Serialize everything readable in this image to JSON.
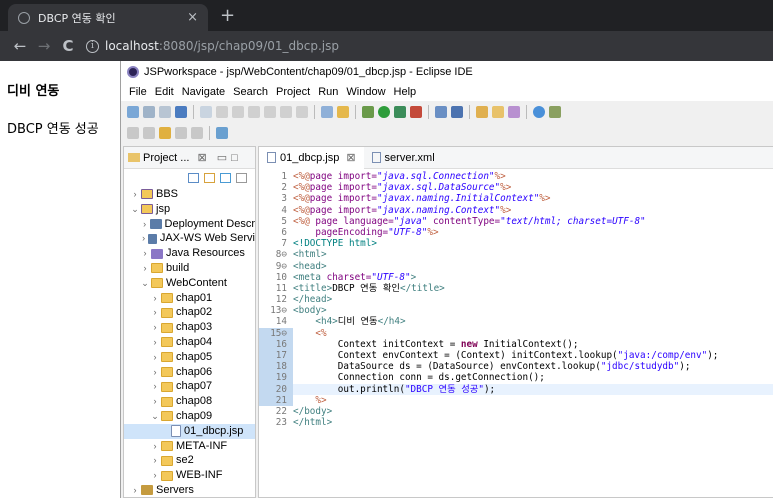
{
  "browser": {
    "tab_title": "DBCP 연동 확인",
    "tab_close": "×",
    "new_tab": "+",
    "url_host": "localhost",
    "url_rest": ":8080/jsp/chap09/01_dbcp.jsp"
  },
  "page": {
    "heading": "디비 연동",
    "message": "DBCP 연동 성공"
  },
  "eclipse": {
    "title": "JSPworkspace - jsp/WebContent/chap09/01_dbcp.jsp - Eclipse IDE",
    "menu": [
      "File",
      "Edit",
      "Navigate",
      "Search",
      "Project",
      "Run",
      "Window",
      "Help"
    ],
    "explorer_tab": "Project ...",
    "tree": [
      {
        "label": "BBS",
        "depth": 0,
        "twisty": ">",
        "icon": "proj"
      },
      {
        "label": "jsp",
        "depth": 0,
        "twisty": "v",
        "icon": "proj"
      },
      {
        "label": "Deployment Descr",
        "depth": 1,
        "twisty": ">",
        "icon": "web"
      },
      {
        "label": "JAX-WS Web Servi",
        "depth": 1,
        "twisty": ">",
        "icon": "web"
      },
      {
        "label": "Java Resources",
        "depth": 1,
        "twisty": ">",
        "icon": "lib"
      },
      {
        "label": "build",
        "depth": 1,
        "twisty": ">",
        "icon": "folder"
      },
      {
        "label": "WebContent",
        "depth": 1,
        "twisty": "v",
        "icon": "folder"
      },
      {
        "label": "chap01",
        "depth": 2,
        "twisty": ">",
        "icon": "folder"
      },
      {
        "label": "chap02",
        "depth": 2,
        "twisty": ">",
        "icon": "folder"
      },
      {
        "label": "chap03",
        "depth": 2,
        "twisty": ">",
        "icon": "folder"
      },
      {
        "label": "chap04",
        "depth": 2,
        "twisty": ">",
        "icon": "folder"
      },
      {
        "label": "chap05",
        "depth": 2,
        "twisty": ">",
        "icon": "folder"
      },
      {
        "label": "chap06",
        "depth": 2,
        "twisty": ">",
        "icon": "folder"
      },
      {
        "label": "chap07",
        "depth": 2,
        "twisty": ">",
        "icon": "folder"
      },
      {
        "label": "chap08",
        "depth": 2,
        "twisty": ">",
        "icon": "folder"
      },
      {
        "label": "chap09",
        "depth": 2,
        "twisty": "v",
        "icon": "folder"
      },
      {
        "label": "01_dbcp.jsp",
        "depth": 3,
        "twisty": "",
        "icon": "jsp",
        "selected": true
      },
      {
        "label": "META-INF",
        "depth": 2,
        "twisty": ">",
        "icon": "folder"
      },
      {
        "label": "se2",
        "depth": 2,
        "twisty": ">",
        "icon": "folder"
      },
      {
        "label": "WEB-INF",
        "depth": 2,
        "twisty": ">",
        "icon": "folder"
      },
      {
        "label": "Servers",
        "depth": 0,
        "twisty": ">",
        "icon": "srv"
      }
    ],
    "editor_tabs": [
      {
        "label": "01_dbcp.jsp",
        "active": true
      },
      {
        "label": "server.xml",
        "active": false
      }
    ],
    "code_lines": [
      {
        "n": "1",
        "fold": false,
        "html": "<span class=\"dir\">&lt;%@</span><span class=\"attr\">page import=</span><span class=\"val\">\"java.sql.Connection\"</span><span class=\"dir\">%&gt;</span>"
      },
      {
        "n": "2",
        "fold": false,
        "html": "<span class=\"dir\">&lt;%@</span><span class=\"attr\">page import=</span><span class=\"val\">\"javax.sql.DataSource\"</span><span class=\"dir\">%&gt;</span>"
      },
      {
        "n": "3",
        "fold": false,
        "html": "<span class=\"dir\">&lt;%@</span><span class=\"attr\">page import=</span><span class=\"val\">\"javax.naming.InitialContext\"</span><span class=\"dir\">%&gt;</span>"
      },
      {
        "n": "4",
        "fold": false,
        "html": "<span class=\"dir\">&lt;%@</span><span class=\"attr\">page import=</span><span class=\"val\">\"javax.naming.Context\"</span><span class=\"dir\">%&gt;</span>"
      },
      {
        "n": "5",
        "fold": false,
        "html": "<span class=\"dir\">&lt;%@ </span><span class=\"attr\">page language=</span><span class=\"val\">\"java\"</span><span class=\"attr\"> contentType=</span><span class=\"val\">\"text/html; charset=UTF-8\"</span>"
      },
      {
        "n": "6",
        "fold": false,
        "html": "    <span class=\"attr\">pageEncoding=</span><span class=\"val\">\"UTF-8\"</span><span class=\"dir\">%&gt;</span>"
      },
      {
        "n": "7",
        "fold": false,
        "html": "<span class=\"doctype\">&lt;!DOCTYPE html&gt;</span>"
      },
      {
        "n": "8⊖",
        "fold": false,
        "html": "<span class=\"tag\">&lt;html&gt;</span>"
      },
      {
        "n": "9⊖",
        "fold": false,
        "html": "<span class=\"tag\">&lt;head&gt;</span>"
      },
      {
        "n": "10",
        "fold": false,
        "html": "<span class=\"tag\">&lt;meta </span><span class=\"attr\">charset=</span><span class=\"val\">\"UTF-8\"</span><span class=\"tag\">&gt;</span>"
      },
      {
        "n": "11",
        "fold": false,
        "html": "<span class=\"tag\">&lt;title&gt;</span>DBCP 연동 확인<span class=\"tag\">&lt;/title&gt;</span>"
      },
      {
        "n": "12",
        "fold": false,
        "html": "<span class=\"tag\">&lt;/head&gt;</span>"
      },
      {
        "n": "13⊖",
        "fold": false,
        "html": "<span class=\"tag\">&lt;body&gt;</span>"
      },
      {
        "n": "14",
        "fold": false,
        "html": "    <span class=\"tag\">&lt;h4&gt;</span>디비 연동<span class=\"tag\">&lt;/h4&gt;</span>"
      },
      {
        "n": "15⊖",
        "fold": true,
        "html": "    <span class=\"dir\">&lt;%</span>"
      },
      {
        "n": "16",
        "fold": true,
        "html": "        Context initContext = <span class=\"kw\">new</span> InitialContext();"
      },
      {
        "n": "17",
        "fold": true,
        "html": "        Context envContext = (Context) initContext.lookup(<span class=\"str\">\"java:/comp/env\"</span>);"
      },
      {
        "n": "18",
        "fold": true,
        "html": "        DataSource ds = (DataSource) envContext.lookup(<span class=\"str\">\"jdbc/studydb\"</span>);"
      },
      {
        "n": "19",
        "fold": true,
        "html": "        Connection conn = ds.getConnection();"
      },
      {
        "n": "20",
        "fold": true,
        "current": true,
        "html": "        out.println(<span class=\"str\">\"DBCP 연동 성공\"</span>);"
      },
      {
        "n": "21",
        "fold": true,
        "html": "    <span class=\"dir\">%&gt;</span>"
      },
      {
        "n": "22",
        "fold": false,
        "html": "<span class=\"tag\">&lt;/body&gt;</span>"
      },
      {
        "n": "23",
        "fold": false,
        "html": "<span class=\"tag\">&lt;/html&gt;</span>"
      }
    ]
  }
}
